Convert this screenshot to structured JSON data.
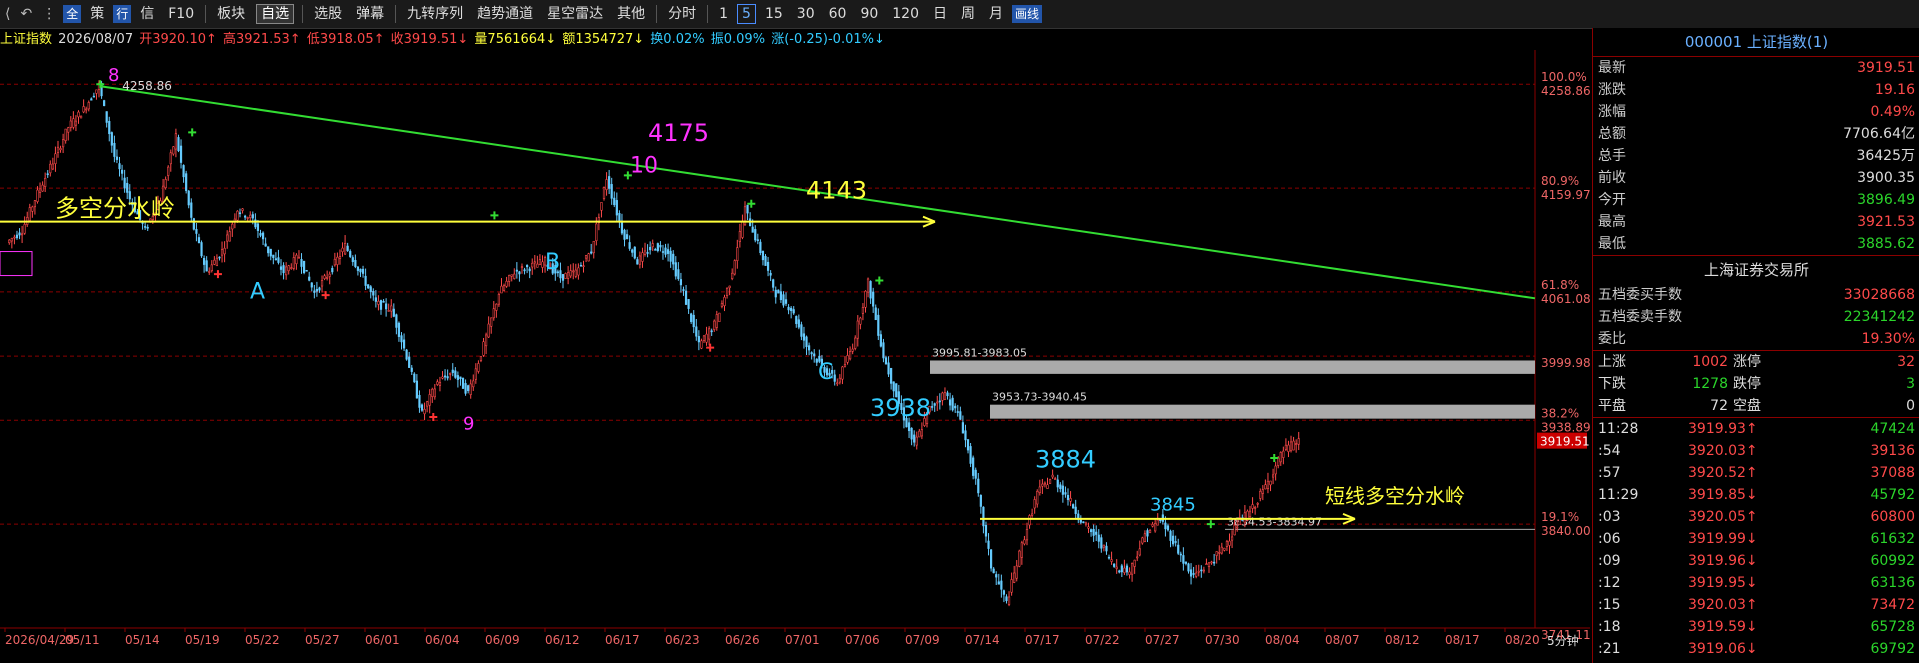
{
  "toolbar": {
    "items": [
      "全",
      "策",
      "行",
      "信",
      "F10",
      "板块",
      "自选",
      "选股",
      "弹幕",
      "九转序列",
      "趋势通道",
      "星空雷达",
      "其他",
      "分时",
      "1",
      "5",
      "15",
      "30",
      "60",
      "90",
      "120",
      "日",
      "周",
      "月",
      "画线"
    ]
  },
  "info": {
    "name": "上证指数",
    "date": "2026/08/07",
    "open": "开3920.10↑",
    "high": "高3921.53↑",
    "low": "低3918.05↑",
    "close": "收3919.51↓",
    "volume": "量7561664↓",
    "amount": "额1354727↓",
    "turnover": "换0.02%",
    "amplitude": "振0.09%",
    "change": "涨(-0.25)-0.01%↓"
  },
  "chart_data": {
    "type": "candlestick",
    "period": "5分钟",
    "ylim": [
      3741.11,
      4280
    ],
    "x_ticks": [
      "2026/04/29",
      "05/11",
      "05/14",
      "05/19",
      "05/22",
      "05/27",
      "06/01",
      "06/04",
      "06/09",
      "06/12",
      "06/17",
      "06/23",
      "06/26",
      "07/01",
      "07/06",
      "07/09",
      "07/14",
      "07/17",
      "07/22",
      "07/27",
      "07/30",
      "08/04",
      "08/07",
      "08/12",
      "08/17",
      "08/20"
    ],
    "price_levels": [
      {
        "pct": "100.0%",
        "price": "4258.86",
        "value": 4258.86
      },
      {
        "pct": "80.9%",
        "price": "4159.97",
        "value": 4159.97
      },
      {
        "pct": "61.8%",
        "price": "4061.08",
        "value": 4061.08
      },
      {
        "pct": "",
        "price": "3999.98",
        "value": 3999.98
      },
      {
        "pct": "38.2%",
        "price": "3938.89",
        "value": 3938.89
      },
      {
        "pct": "19.1%",
        "price": "3840.00",
        "value": 3840.0
      },
      {
        "pct": "",
        "price": "3741.11",
        "value": 3741.11
      }
    ],
    "current_price": "3919.51",
    "peak_label": "4258.86",
    "zones": [
      {
        "label": "3995.81-3983.05",
        "top": 3995.81,
        "bottom": 3983.05
      },
      {
        "label": "3953.73-3940.45",
        "top": 3953.73,
        "bottom": 3940.45
      },
      {
        "label": "3834.53-3834.97",
        "top": 3834.97,
        "bottom": 3834.53
      }
    ],
    "annotations": [
      {
        "text": "8",
        "color": "#ff33ff"
      },
      {
        "text": "4175",
        "color": "#ff33ff"
      },
      {
        "text": "10",
        "color": "#ff33ff"
      },
      {
        "text": "4143",
        "color": "#ffff3c"
      },
      {
        "text": "多空分水岭",
        "color": "#ffff3c"
      },
      {
        "text": "A",
        "color": "#33ccff"
      },
      {
        "text": "B",
        "color": "#33ccff"
      },
      {
        "text": "C",
        "color": "#33ccff"
      },
      {
        "text": "9",
        "color": "#ff33ff"
      },
      {
        "text": "3938",
        "color": "#33ccff"
      },
      {
        "text": "3884",
        "color": "#33ccff"
      },
      {
        "text": "3845",
        "color": "#33ccff"
      },
      {
        "text": "短线多空分水岭",
        "color": "#ffff3c"
      }
    ],
    "series": [
      {
        "x": 0,
        "y": 4108
      },
      {
        "x": 1,
        "y": 4120
      },
      {
        "x": 2,
        "y": 4155
      },
      {
        "x": 3,
        "y": 4185
      },
      {
        "x": 4,
        "y": 4218
      },
      {
        "x": 5,
        "y": 4235
      },
      {
        "x": 6,
        "y": 4258
      },
      {
        "x": 7,
        "y": 4190
      },
      {
        "x": 8,
        "y": 4150
      },
      {
        "x": 9,
        "y": 4120
      },
      {
        "x": 10,
        "y": 4150
      },
      {
        "x": 11,
        "y": 4210
      },
      {
        "x": 12,
        "y": 4130
      },
      {
        "x": 13,
        "y": 4080
      },
      {
        "x": 14,
        "y": 4100
      },
      {
        "x": 15,
        "y": 4140
      },
      {
        "x": 16,
        "y": 4130
      },
      {
        "x": 17,
        "y": 4100
      },
      {
        "x": 18,
        "y": 4080
      },
      {
        "x": 19,
        "y": 4095
      },
      {
        "x": 20,
        "y": 4060
      },
      {
        "x": 21,
        "y": 4080
      },
      {
        "x": 22,
        "y": 4105
      },
      {
        "x": 23,
        "y": 4080
      },
      {
        "x": 24,
        "y": 4050
      },
      {
        "x": 25,
        "y": 4045
      },
      {
        "x": 26,
        "y": 4000
      },
      {
        "x": 27,
        "y": 3945
      },
      {
        "x": 28,
        "y": 3975
      },
      {
        "x": 29,
        "y": 3985
      },
      {
        "x": 30,
        "y": 3965
      },
      {
        "x": 31,
        "y": 4010
      },
      {
        "x": 32,
        "y": 4060
      },
      {
        "x": 33,
        "y": 4080
      },
      {
        "x": 34,
        "y": 4085
      },
      {
        "x": 35,
        "y": 4090
      },
      {
        "x": 36,
        "y": 4075
      },
      {
        "x": 37,
        "y": 4080
      },
      {
        "x": 38,
        "y": 4100
      },
      {
        "x": 39,
        "y": 4170
      },
      {
        "x": 40,
        "y": 4120
      },
      {
        "x": 41,
        "y": 4090
      },
      {
        "x": 42,
        "y": 4105
      },
      {
        "x": 43,
        "y": 4100
      },
      {
        "x": 44,
        "y": 4060
      },
      {
        "x": 45,
        "y": 4010
      },
      {
        "x": 46,
        "y": 4030
      },
      {
        "x": 47,
        "y": 4070
      },
      {
        "x": 48,
        "y": 4140
      },
      {
        "x": 49,
        "y": 4100
      },
      {
        "x": 50,
        "y": 4060
      },
      {
        "x": 51,
        "y": 4045
      },
      {
        "x": 52,
        "y": 4010
      },
      {
        "x": 53,
        "y": 3990
      },
      {
        "x": 54,
        "y": 3975
      },
      {
        "x": 55,
        "y": 4010
      },
      {
        "x": 56,
        "y": 4070
      },
      {
        "x": 57,
        "y": 4000
      },
      {
        "x": 58,
        "y": 3955
      },
      {
        "x": 59,
        "y": 3915
      },
      {
        "x": 60,
        "y": 3950
      },
      {
        "x": 61,
        "y": 3965
      },
      {
        "x": 62,
        "y": 3940
      },
      {
        "x": 63,
        "y": 3880
      },
      {
        "x": 64,
        "y": 3800
      },
      {
        "x": 65,
        "y": 3765
      },
      {
        "x": 66,
        "y": 3820
      },
      {
        "x": 67,
        "y": 3870
      },
      {
        "x": 68,
        "y": 3885
      },
      {
        "x": 69,
        "y": 3865
      },
      {
        "x": 70,
        "y": 3840
      },
      {
        "x": 71,
        "y": 3825
      },
      {
        "x": 72,
        "y": 3800
      },
      {
        "x": 73,
        "y": 3795
      },
      {
        "x": 74,
        "y": 3830
      },
      {
        "x": 75,
        "y": 3845
      },
      {
        "x": 76,
        "y": 3820
      },
      {
        "x": 77,
        "y": 3790
      },
      {
        "x": 78,
        "y": 3800
      },
      {
        "x": 79,
        "y": 3815
      },
      {
        "x": 80,
        "y": 3840
      },
      {
        "x": 81,
        "y": 3855
      },
      {
        "x": 82,
        "y": 3880
      },
      {
        "x": 83,
        "y": 3910
      },
      {
        "x": 84,
        "y": 3919
      }
    ]
  },
  "panel": {
    "title": "000001 上证指数(1)",
    "stats": [
      {
        "k": "最新",
        "v": "3919.51",
        "c": "red"
      },
      {
        "k": "涨跌",
        "v": "19.16",
        "c": "red"
      },
      {
        "k": "涨幅",
        "v": "0.49%",
        "c": "red"
      },
      {
        "k": "总额",
        "v": "7706.64亿",
        "c": "white"
      },
      {
        "k": "总手",
        "v": "36425万",
        "c": "white"
      },
      {
        "k": "前收",
        "v": "3900.35",
        "c": "white"
      },
      {
        "k": "今开",
        "v": "3896.49",
        "c": "green"
      },
      {
        "k": "最高",
        "v": "3921.53",
        "c": "red"
      },
      {
        "k": "最低",
        "v": "3885.62",
        "c": "green"
      }
    ],
    "exchange": "上海证券交易所",
    "orders": [
      {
        "k": "五档委买手数",
        "v": "33028668",
        "c": "red"
      },
      {
        "k": "五档委卖手数",
        "v": "22341242",
        "c": "green"
      },
      {
        "k": "委比",
        "v": "19.30%",
        "c": "red"
      }
    ],
    "breadth": [
      {
        "k1": "上涨",
        "v1": "1002",
        "c1": "red",
        "k2": "涨停",
        "v2": "32",
        "c2": "red"
      },
      {
        "k1": "下跌",
        "v1": "1278",
        "c1": "green",
        "k2": "跌停",
        "v2": "3",
        "c2": "green"
      },
      {
        "k1": "平盘",
        "v1": "72",
        "c1": "white",
        "k2": "空盘",
        "v2": "0",
        "c2": "white"
      }
    ],
    "ticks": [
      {
        "t": "11:28",
        "p": "3919.93↑",
        "pc": "red",
        "v": "47424",
        "vc": "green"
      },
      {
        "t": ":54",
        "p": "3920.03↑",
        "pc": "red",
        "v": "39136",
        "vc": "red"
      },
      {
        "t": ":57",
        "p": "3920.52↑",
        "pc": "red",
        "v": "37088",
        "vc": "red"
      },
      {
        "t": "11:29",
        "p": "3919.85↓",
        "pc": "red",
        "v": "45792",
        "vc": "green"
      },
      {
        "t": ":03",
        "p": "3920.05↑",
        "pc": "red",
        "v": "60800",
        "vc": "red"
      },
      {
        "t": ":06",
        "p": "3919.99↓",
        "pc": "red",
        "v": "61632",
        "vc": "green"
      },
      {
        "t": ":09",
        "p": "3919.96↓",
        "pc": "red",
        "v": "60992",
        "vc": "green"
      },
      {
        "t": ":12",
        "p": "3919.95↓",
        "pc": "red",
        "v": "63136",
        "vc": "green"
      },
      {
        "t": ":15",
        "p": "3920.03↑",
        "pc": "red",
        "v": "73472",
        "vc": "red"
      },
      {
        "t": ":18",
        "p": "3919.59↓",
        "pc": "red",
        "v": "65728",
        "vc": "green"
      },
      {
        "t": ":21",
        "p": "3919.06↓",
        "pc": "red",
        "v": "69792",
        "vc": "green"
      }
    ]
  }
}
